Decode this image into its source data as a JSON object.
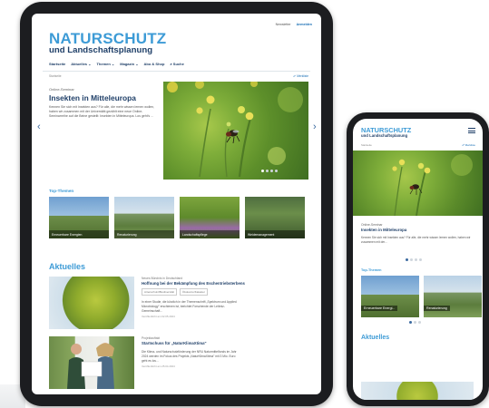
{
  "tablet": {
    "top_links": {
      "newsletter": "Newsletter",
      "login": "Anmelden"
    },
    "logo": {
      "line1": "NATURSCHUTZ",
      "line2": "und Landschaftsplanung"
    },
    "nav": [
      {
        "label": "Startseite"
      },
      {
        "label": "Aktuelles ⌄"
      },
      {
        "label": "Themen ⌄"
      },
      {
        "label": "Magazin ⌄"
      },
      {
        "label": "Abo & Shop"
      },
      {
        "label": "⌕ Suche"
      }
    ],
    "breadcrumb": "Startseite",
    "merkliste": "☍ Merkliste",
    "hero": {
      "kicker": "Online-Seminar",
      "title": "Insekten in Mitteleuropa",
      "body": "Kennen Sie sich mit Insekten aus? Für alle, die mehr wissen lernen wollen, haben wir zusammen mit der Universität gezählt eine neue Online-Seminarreihe auf die Beine gestellt: Insekten in Mitteleuropa. Los geht's ..."
    },
    "top_themen_label": "Top-Themen",
    "themes": [
      {
        "label": "Erneuerbare Energien"
      },
      {
        "label": "Renaturierung"
      },
      {
        "label": "Landschaftspflege"
      },
      {
        "label": "Weidemanagement"
      }
    ],
    "aktuelles_label": "Aktuelles",
    "articles": [
      {
        "meta": "Neues Bündnis in Deutschland",
        "title": "Hoffnung bei der Bekämpfung des Eschentriebsterbens",
        "tags": [
          "Artenschutz/Biodiversität",
          "Ökokonto/Kataster"
        ],
        "body": "In einer Studie, die kürzlich in der Themenschrift „Spektrum und Applied Microbiology\" erschienen ist, berichtet Forschende der Leibniz-Gemeinschaft...",
        "date": "Veröffentlicht am 02.05.2024"
      },
      {
        "meta": "Projektauftakt",
        "title": "Startschuss für „NaturKlimaXtima\"",
        "tags": [],
        "body": "Die Klima- und Naturschutzförderung der NRU Naturmittelfonds im Jahr 2024 werden im Fokus des Projekts „NaturKlimaXtima\" mit 3 Mio. Euro geht es los...",
        "date": "Veröffentlicht am 25.04.2024"
      }
    ]
  },
  "phone": {
    "logo": {
      "line1": "NATURSCHUTZ",
      "line2": "und Landschaftsplanung"
    },
    "breadcrumb": "Startseite",
    "merkliste": "☍ Merkliste",
    "hero": {
      "kicker": "Online-Seminar",
      "title": "Insekten in Mitteleuropa",
      "body": "Kennen Sie sich mit Insekten aus? Für alle, die mehr wissen lernen wollen, haben wir zusammen mit der..."
    },
    "top_themen_label": "Top-Themen",
    "themes": [
      {
        "label": "Erneuerbare Energi..."
      },
      {
        "label": "Renaturierung"
      }
    ],
    "aktuelles_label": "Aktuelles"
  },
  "colors": {
    "accent": "#3d9bd6",
    "navy": "#1f3f68",
    "frame": "#1c1d20"
  },
  "icons": {
    "arrow_left": "chevron-left-icon",
    "arrow_right": "chevron-right-icon",
    "menu": "hamburger-menu-icon"
  }
}
